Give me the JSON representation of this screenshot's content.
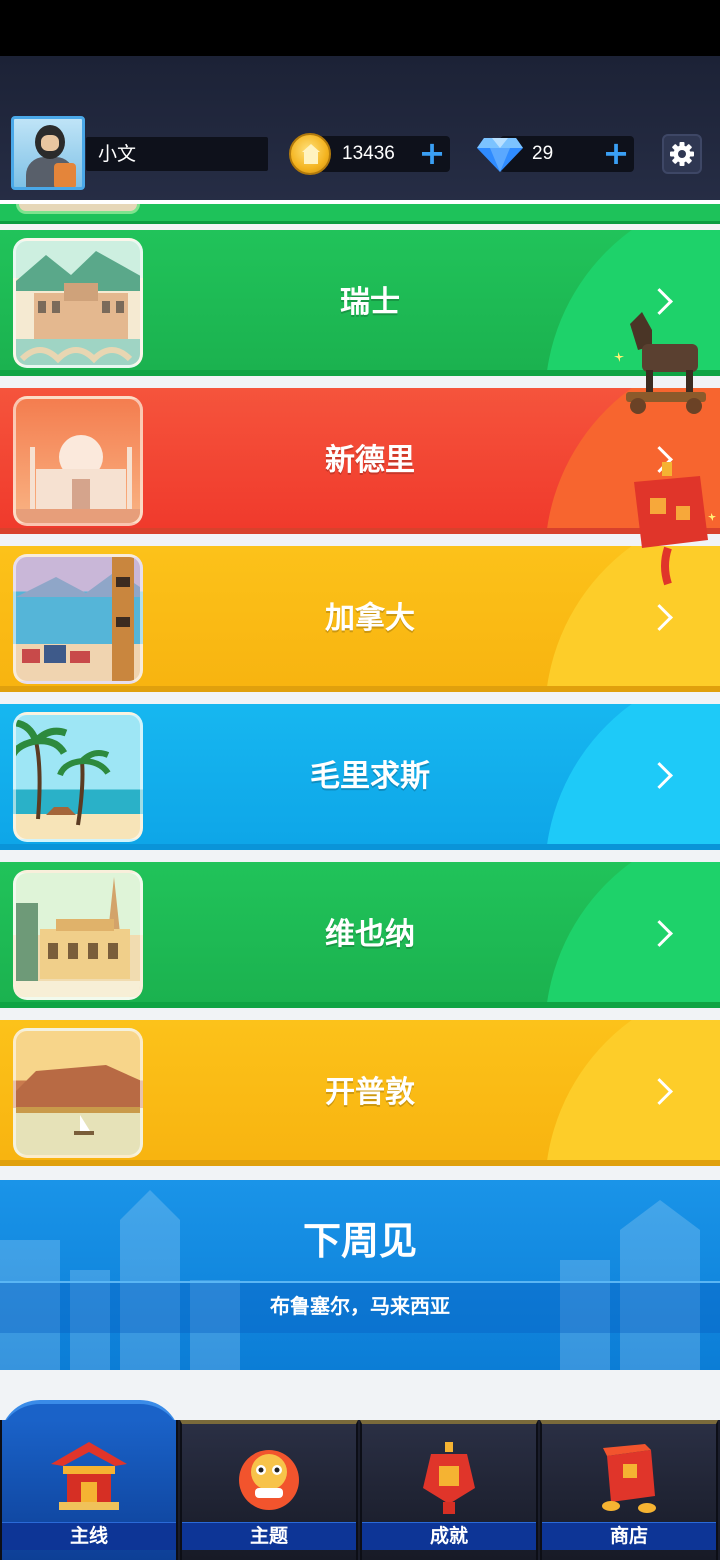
{
  "profile": {
    "name": "小文"
  },
  "currencies": {
    "coins": "13436",
    "gems": "29",
    "add_symbol": "+"
  },
  "cities": [
    {
      "name": "瑞士",
      "color": "green"
    },
    {
      "name": "新德里",
      "color": "red"
    },
    {
      "name": "加拿大",
      "color": "yellow"
    },
    {
      "name": "毛里求斯",
      "color": "blue"
    },
    {
      "name": "维也纳",
      "color": "green"
    },
    {
      "name": "开普敦",
      "color": "yellow"
    }
  ],
  "next_week": {
    "title": "下周见",
    "subtitle": "布鲁塞尔，马来西亚"
  },
  "tabs": [
    {
      "label": "主线",
      "icon": "pavilion-icon",
      "active": true
    },
    {
      "label": "主题",
      "icon": "lion-dance-icon",
      "active": false
    },
    {
      "label": "成就",
      "icon": "fu-lantern-icon",
      "active": false
    },
    {
      "label": "商店",
      "icon": "gift-box-icon",
      "active": false
    }
  ],
  "colors": {
    "green": "#21c35a",
    "red": "#f5543c",
    "yellow": "#fcc21a",
    "blue": "#17b7f0",
    "accent": "#3a9ff4"
  }
}
